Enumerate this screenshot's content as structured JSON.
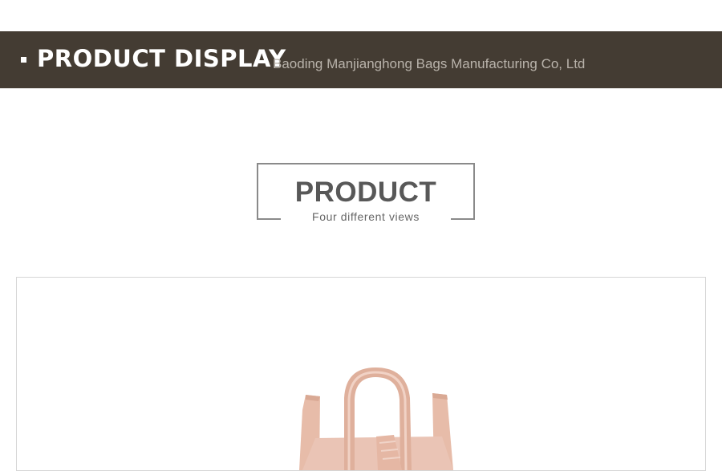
{
  "banner": {
    "title": "PRODUCT DISPLAY",
    "subtitle": "Baoding Manjianghong Bags Manufacturing Co, Ltd"
  },
  "section": {
    "title": "PRODUCT",
    "subtitle": "Four different views"
  },
  "colors": {
    "banner_bg": "#443c33",
    "bag": "#e9c2b4"
  },
  "product": {
    "image_icon": "pink-canvas-bag-image"
  }
}
